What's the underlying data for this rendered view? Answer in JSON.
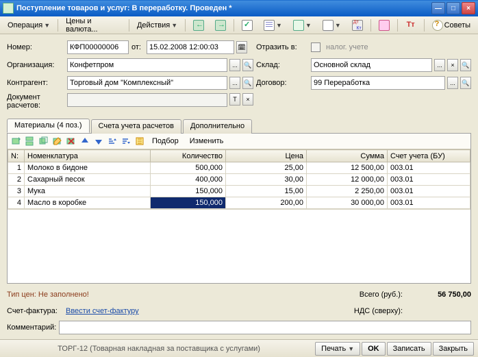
{
  "window": {
    "title": "Поступление товаров и услуг: В переработку. Проведен *"
  },
  "toolbar": {
    "operation": "Операция",
    "prices": "Цены и валюта...",
    "actions": "Действия",
    "advice": "Советы"
  },
  "form": {
    "number_label": "Номер:",
    "number": "КФП00000006",
    "from_label": "от:",
    "date": "15.02.2008 12:00:03",
    "reflect_label": "Отразить в:",
    "tax_account": "налог. учете",
    "org_label": "Организация:",
    "org": "Конфетпром",
    "warehouse_label": "Склад:",
    "warehouse": "Основной склад",
    "counterparty_label": "Контрагент:",
    "counterparty": "Торговый дом \"Комплексный\"",
    "contract_label": "Договор:",
    "contract": "99 Переработка",
    "settlement_label": "Документ расчетов:"
  },
  "tabs": {
    "materials": "Материалы (4 поз.)",
    "accounts": "Счета учета расчетов",
    "additional": "Дополнительно"
  },
  "grid_toolbar": {
    "select": "Подбор",
    "change": "Изменить"
  },
  "grid": {
    "col_n": "N:",
    "col_nom": "Номенклатура",
    "col_qty": "Количество",
    "col_price": "Цена",
    "col_sum": "Сумма",
    "col_acc": "Счет учета (БУ)",
    "rows": [
      {
        "n": "1",
        "nom": "Молоко в бидоне",
        "qty": "500,000",
        "price": "25,00",
        "sum": "12 500,00",
        "acc": "003.01"
      },
      {
        "n": "2",
        "nom": "Сахарный песок",
        "qty": "400,000",
        "price": "30,00",
        "sum": "12 000,00",
        "acc": "003.01"
      },
      {
        "n": "3",
        "nom": "Мука",
        "qty": "150,000",
        "price": "15,00",
        "sum": "2 250,00",
        "acc": "003.01"
      },
      {
        "n": "4",
        "nom": "Масло в коробке",
        "qty": "150,000",
        "price": "200,00",
        "sum": "30 000,00",
        "acc": "003.01"
      }
    ]
  },
  "footer": {
    "pricetype": "Тип цен: Не заполнено!",
    "total_label": "Всего (руб.):",
    "total": "56 750,00",
    "invoice_label": "Счет-фактура:",
    "invoice_link": "Ввести счет-фактуру",
    "vat_label": "НДС (сверху):",
    "comment_label": "Комментарий:"
  },
  "statusbar": {
    "form_name": "ТОРГ-12 (Товарная накладная за поставщика с услугами)",
    "print": "Печать",
    "ok": "OK",
    "write": "Записать",
    "close": "Закрыть"
  }
}
